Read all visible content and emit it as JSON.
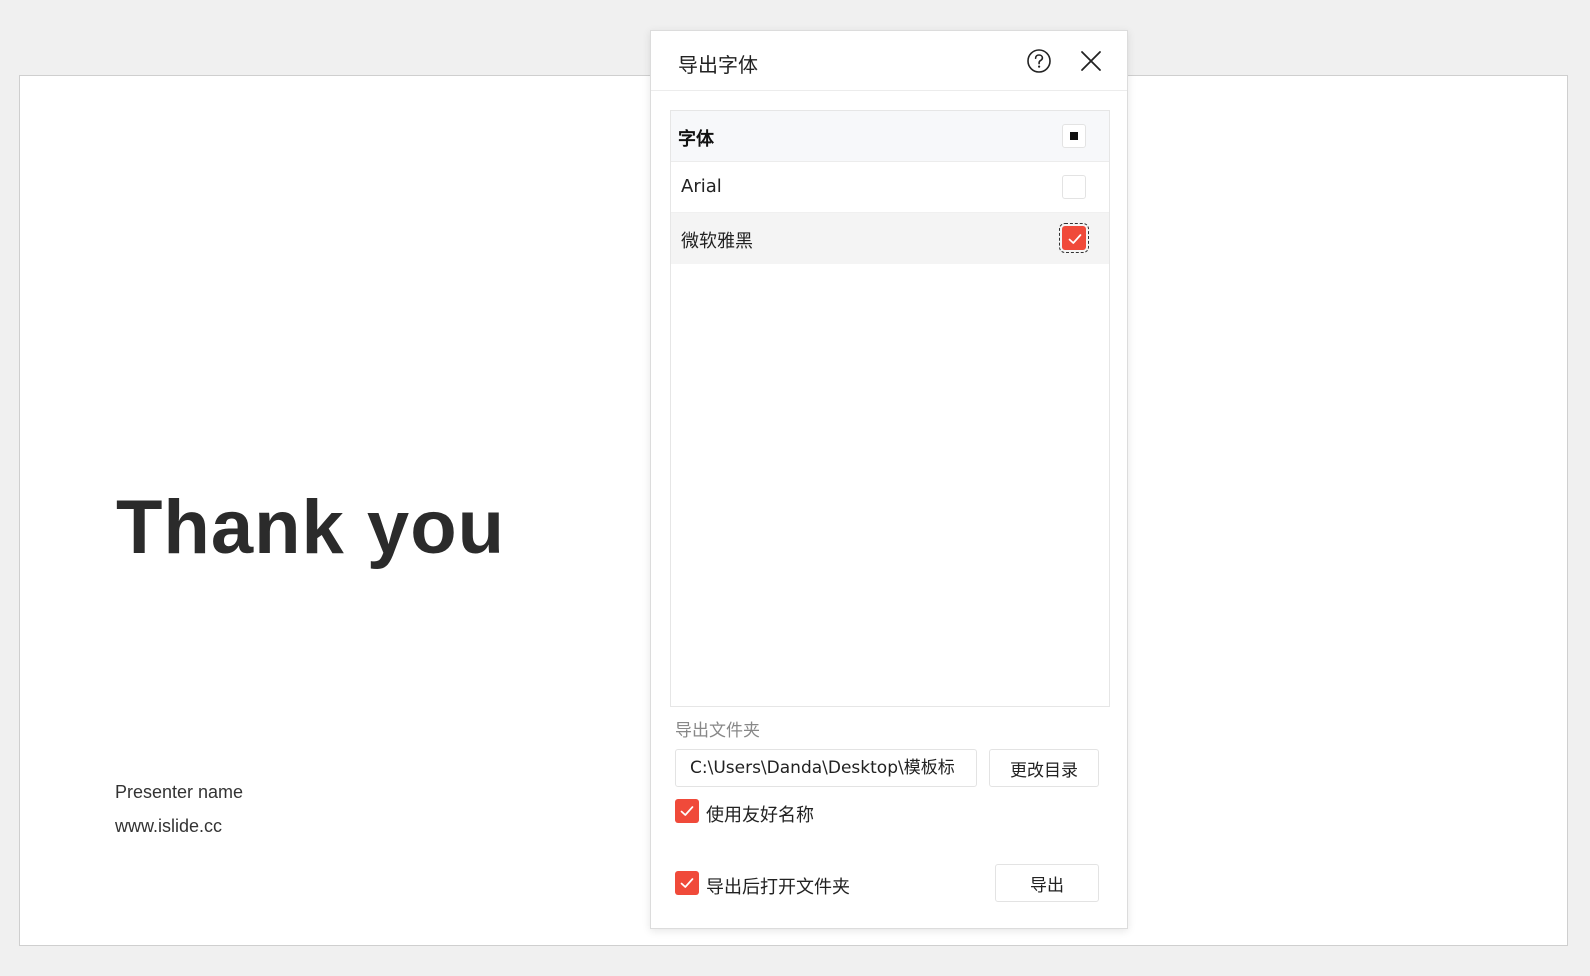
{
  "slide": {
    "title": "Thank you",
    "presenter": "Presenter name",
    "website": "www.islide.cc"
  },
  "dialog": {
    "title": "导出字体",
    "help_icon": "help-circle-icon",
    "close_icon": "close-icon",
    "table": {
      "header_label": "字体",
      "header_state": "indeterminate",
      "rows": [
        {
          "label": "Arial",
          "checked": false
        },
        {
          "label": "微软雅黑",
          "checked": true
        }
      ]
    },
    "folder": {
      "label": "导出文件夹",
      "path": "C:\\Users\\Danda\\Desktop\\模板标",
      "change_dir_label": "更改目录"
    },
    "options": {
      "friendly_name_label": "使用友好名称",
      "friendly_name_checked": true,
      "open_folder_label": "导出后打开文件夹",
      "open_folder_checked": true
    },
    "export_label": "导出"
  },
  "colors": {
    "accent": "#f04a3a",
    "background": "#f0f0f0",
    "panel": "#ffffff"
  }
}
